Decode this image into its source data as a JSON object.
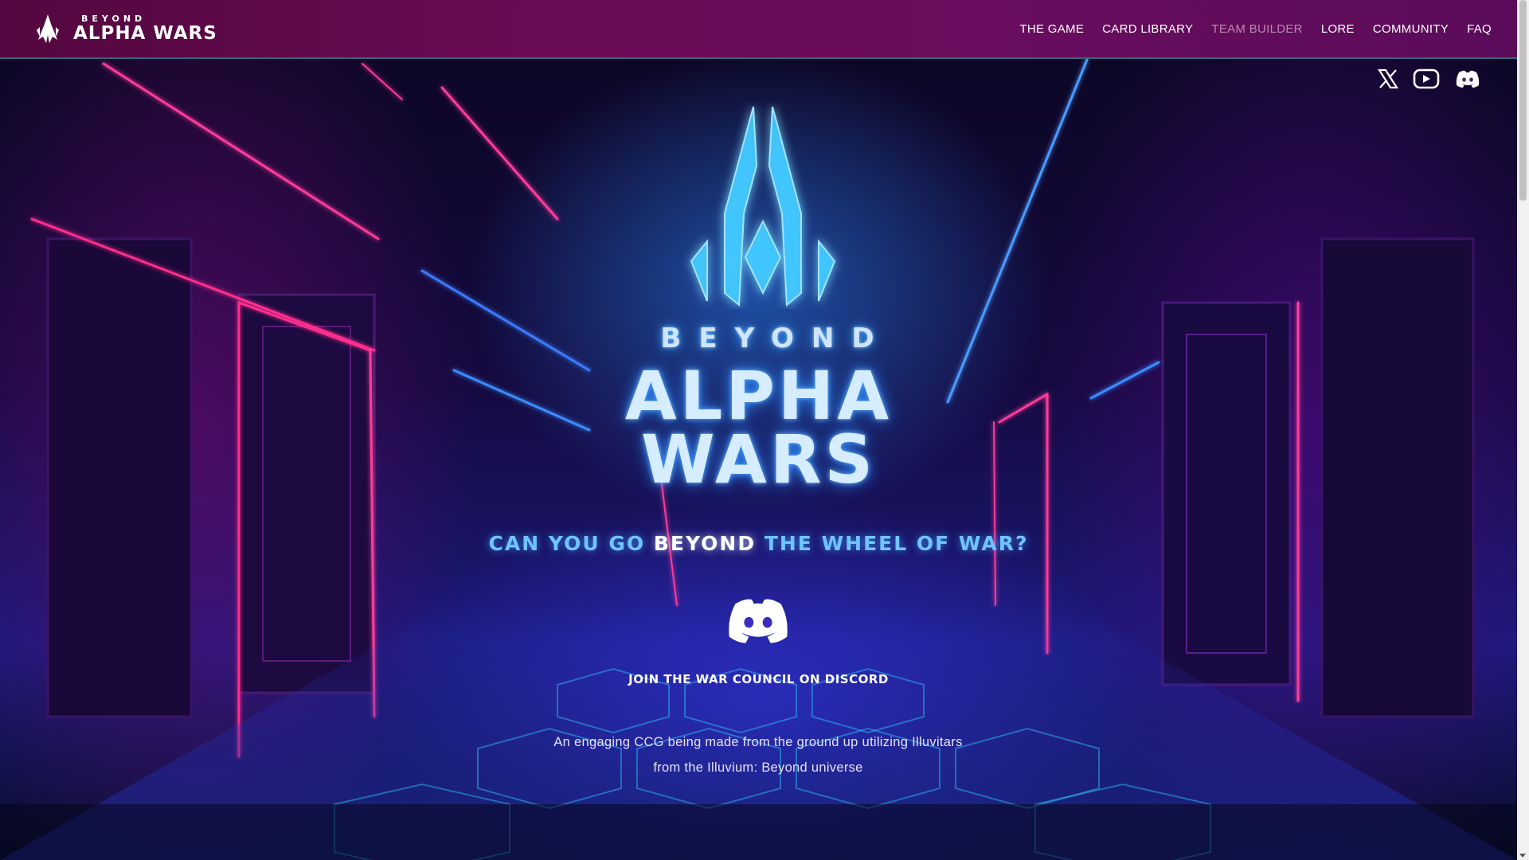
{
  "header": {
    "brand_small": "BEYOND",
    "brand_big": "ALPHA WARS",
    "nav": [
      {
        "label": "THE GAME"
      },
      {
        "label": "CARD LIBRARY"
      },
      {
        "label": "TEAM BUILDER"
      },
      {
        "label": "LORE"
      },
      {
        "label": "COMMUNITY"
      },
      {
        "label": "FAQ"
      }
    ]
  },
  "social": {
    "icons": [
      "x-icon",
      "youtube-icon",
      "discord-icon"
    ]
  },
  "hero": {
    "title_top": "BEYOND",
    "title_line1": "ALPHA",
    "title_line2": "WARS",
    "tagline_pre": "CAN YOU GO ",
    "tagline_highlight": "BEYOND",
    "tagline_post": " THE WHEEL OF WAR?",
    "join_label": "JOIN THE WAR COUNCIL ON DISCORD",
    "description_line1": "An engaging CCG being made from the ground up utilizing Illuvitars",
    "description_line2": "from the Illuvium: Beyond universe"
  },
  "colors": {
    "header_bg": "#6a0b55",
    "accent_cyan": "#6fc4ff",
    "nav_dim": "#b78bb0"
  }
}
